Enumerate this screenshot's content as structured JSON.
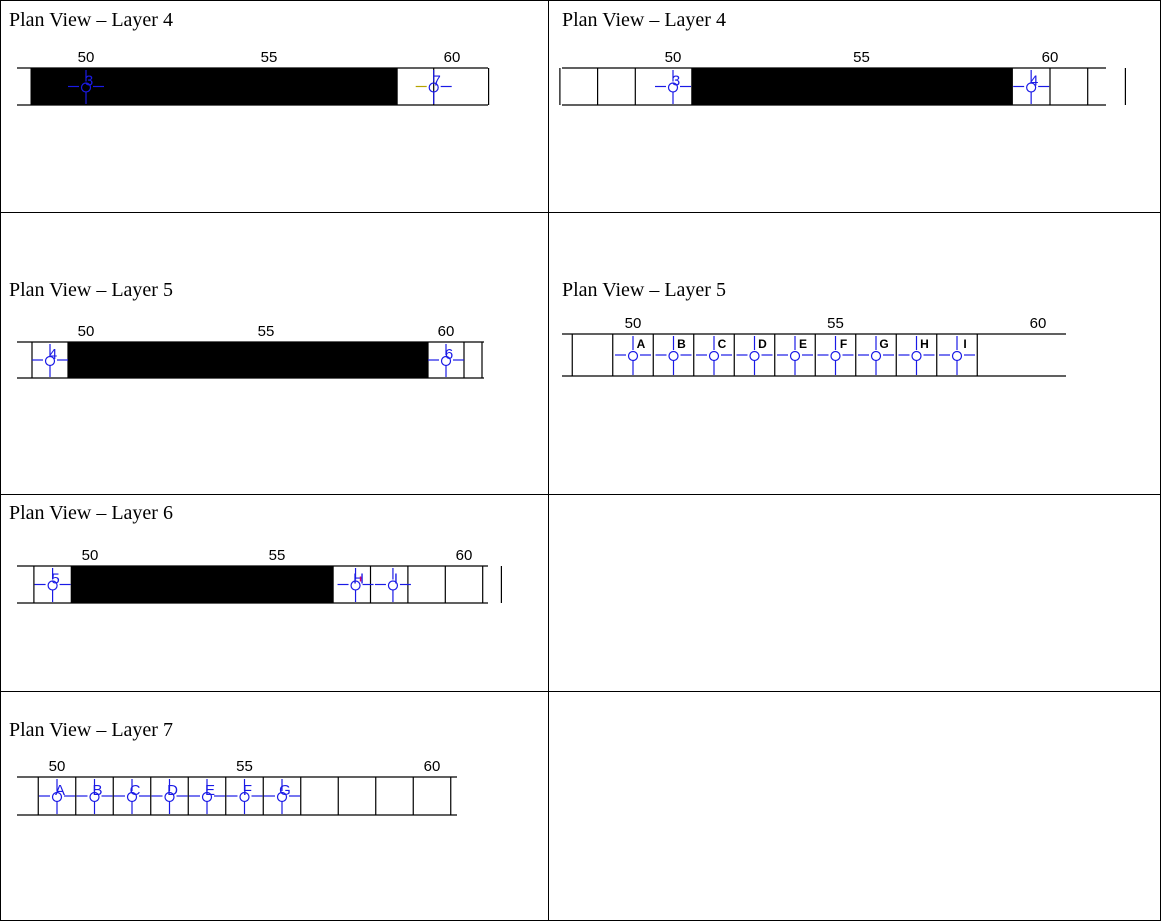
{
  "title_text": "Plan View – Layer",
  "panels": [
    {
      "id": "r1c1",
      "layer": 4,
      "axis": {
        "labels": [
          "50",
          "55",
          "60"
        ]
      },
      "grid_x": [
        41.5,
        48.5,
        56.5,
        58.5,
        59.5,
        61
      ],
      "block": [
        48.5,
        58.5
      ],
      "bays": [
        {
          "x": 50,
          "label": "3",
          "style": "blue"
        },
        {
          "x": 59.5,
          "label": "7",
          "style": "blue",
          "marker": "#b5a400"
        }
      ]
    },
    {
      "id": "r1c2",
      "layer": 4,
      "axis": {
        "labels": [
          "50",
          "55",
          "60"
        ]
      },
      "grid_x": [
        47,
        48,
        49,
        50.5,
        59,
        60,
        61,
        62
      ],
      "block": [
        50.5,
        59
      ],
      "bays": [
        {
          "x": 50,
          "label": "3",
          "style": "blue"
        },
        {
          "x": 59.5,
          "label": "4",
          "style": "blue"
        }
      ]
    },
    {
      "id": "r2c1",
      "layer": 5,
      "axis": {
        "labels": [
          "50",
          "55",
          "60"
        ]
      },
      "grid_x": [
        48.5,
        49.5,
        59.5,
        60.5,
        61
      ],
      "block": [
        49.5,
        59.5
      ],
      "bays": [
        {
          "x": 49,
          "label": "4",
          "style": "blue"
        },
        {
          "x": 60,
          "label": "6",
          "style": "blue"
        }
      ]
    },
    {
      "id": "r2c2",
      "layer": 5,
      "axis": {
        "labels": [
          "50",
          "55",
          "60"
        ]
      },
      "grid_x": [
        48.5,
        49.5,
        50.5,
        51.5,
        52.5,
        53.5,
        54.5,
        55.5,
        56.5,
        57.5,
        58.5
      ],
      "block": null,
      "bays": [
        {
          "x": 50.0,
          "label": "A",
          "style": "black"
        },
        {
          "x": 51.0,
          "label": "B",
          "style": "black"
        },
        {
          "x": 52.0,
          "label": "C",
          "style": "black"
        },
        {
          "x": 53.0,
          "label": "D",
          "style": "black"
        },
        {
          "x": 54.0,
          "label": "E",
          "style": "black"
        },
        {
          "x": 55.0,
          "label": "F",
          "style": "black"
        },
        {
          "x": 56.0,
          "label": "G",
          "style": "black"
        },
        {
          "x": 57.0,
          "label": "H",
          "style": "black"
        },
        {
          "x": 58.0,
          "label": "I",
          "style": "black"
        }
      ]
    },
    {
      "id": "r3c1",
      "layer": 6,
      "axis": {
        "labels": [
          "50",
          "55",
          "60"
        ]
      },
      "grid_x": [
        48.5,
        49.5,
        56.5,
        57.5,
        58.5,
        59.5,
        60.5,
        61
      ],
      "block": [
        49.5,
        56.5
      ],
      "bays": [
        {
          "x": 49,
          "label": "5",
          "style": "blue"
        },
        {
          "x": 57.1,
          "label": "H",
          "style": "blue",
          "mark": "#d0006f"
        },
        {
          "x": 58.1,
          "label": "I",
          "style": "blue"
        }
      ]
    },
    {
      "id": "r4c1",
      "layer": 7,
      "axis": {
        "labels": [
          "50",
          "55",
          "60"
        ]
      },
      "grid_x": [
        49.5,
        50.5,
        51.5,
        52.5,
        53.5,
        54.5,
        55.5,
        56.5,
        57.5,
        58.5,
        59.5,
        60.5
      ],
      "block": null,
      "bays": [
        {
          "x": 50.0,
          "label": "A",
          "style": "blue"
        },
        {
          "x": 51.0,
          "label": "B",
          "style": "blue"
        },
        {
          "x": 52.0,
          "label": "C",
          "style": "blue"
        },
        {
          "x": 53.0,
          "label": "D",
          "style": "blue"
        },
        {
          "x": 54.0,
          "label": "E",
          "style": "blue"
        },
        {
          "x": 55.0,
          "label": "F",
          "style": "blue"
        },
        {
          "x": 56.0,
          "label": "G",
          "style": "blue"
        }
      ]
    }
  ],
  "colors": {
    "grid": "#000000",
    "blue": "#1a1ae6",
    "black": "#000000",
    "block": "#000000",
    "frame": "#000000"
  }
}
